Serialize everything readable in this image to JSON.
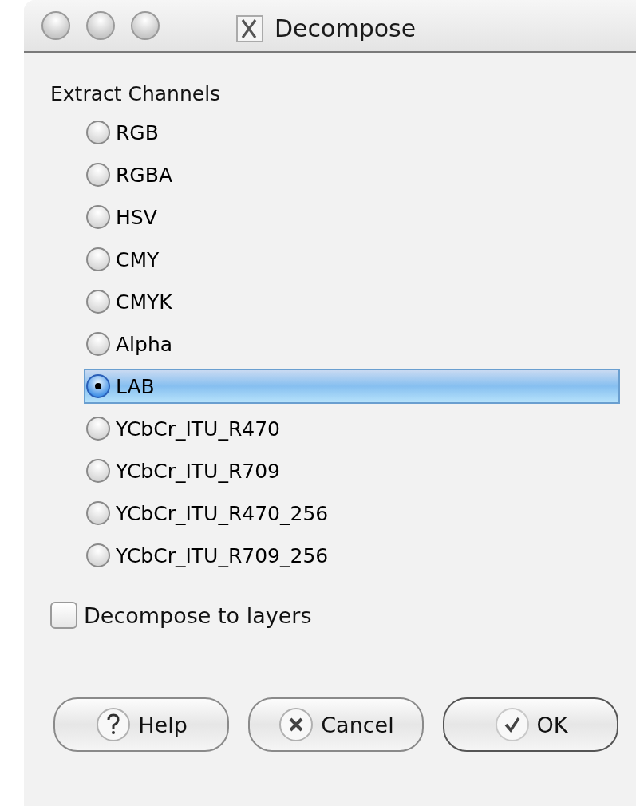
{
  "window": {
    "title": "Decompose"
  },
  "group": {
    "label": "Extract Channels"
  },
  "options": [
    {
      "label": "RGB",
      "selected": false
    },
    {
      "label": "RGBA",
      "selected": false
    },
    {
      "label": "HSV",
      "selected": false
    },
    {
      "label": "CMY",
      "selected": false
    },
    {
      "label": "CMYK",
      "selected": false
    },
    {
      "label": "Alpha",
      "selected": false
    },
    {
      "label": "LAB",
      "selected": true
    },
    {
      "label": "YCbCr_ITU_R470",
      "selected": false
    },
    {
      "label": "YCbCr_ITU_R709",
      "selected": false
    },
    {
      "label": "YCbCr_ITU_R470_256",
      "selected": false
    },
    {
      "label": "YCbCr_ITU_R709_256",
      "selected": false
    }
  ],
  "layers_checkbox": {
    "label": "Decompose to layers",
    "checked": false
  },
  "buttons": [
    {
      "kind": "help",
      "label": "Help"
    },
    {
      "kind": "cancel",
      "label": "Cancel"
    },
    {
      "kind": "ok",
      "label": "OK"
    }
  ]
}
